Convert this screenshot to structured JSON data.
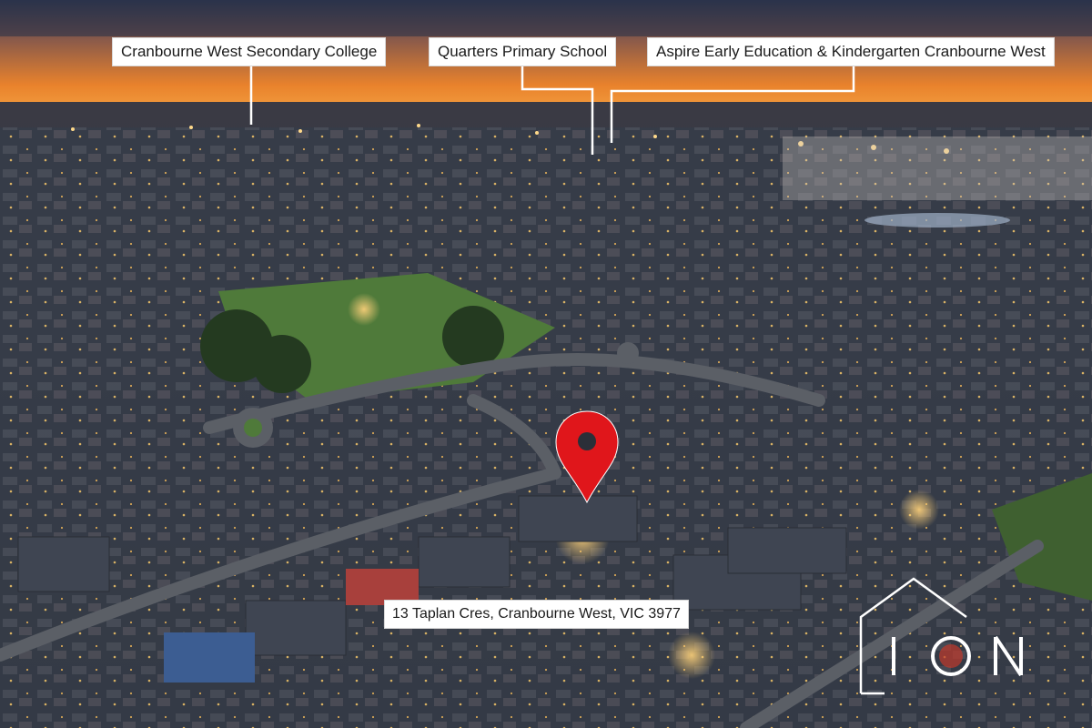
{
  "photo": {
    "sky_top": "#23304a",
    "sky_glow": "#f08a2a",
    "ground": "#2c3340",
    "park_green": "#4f7a3a"
  },
  "callouts": [
    {
      "text": "Cranbourne West Secondary College"
    },
    {
      "text": "Quarters Primary School"
    },
    {
      "text": "Aspire Early Education & Kindergarten Cranbourne West"
    }
  ],
  "property": {
    "address": "13 Taplan Cres, Cranbourne West, VIC 3977",
    "pin_color": "#e0161b"
  },
  "brand": {
    "logo_text": "ION",
    "logo_color": "#ffffff"
  }
}
